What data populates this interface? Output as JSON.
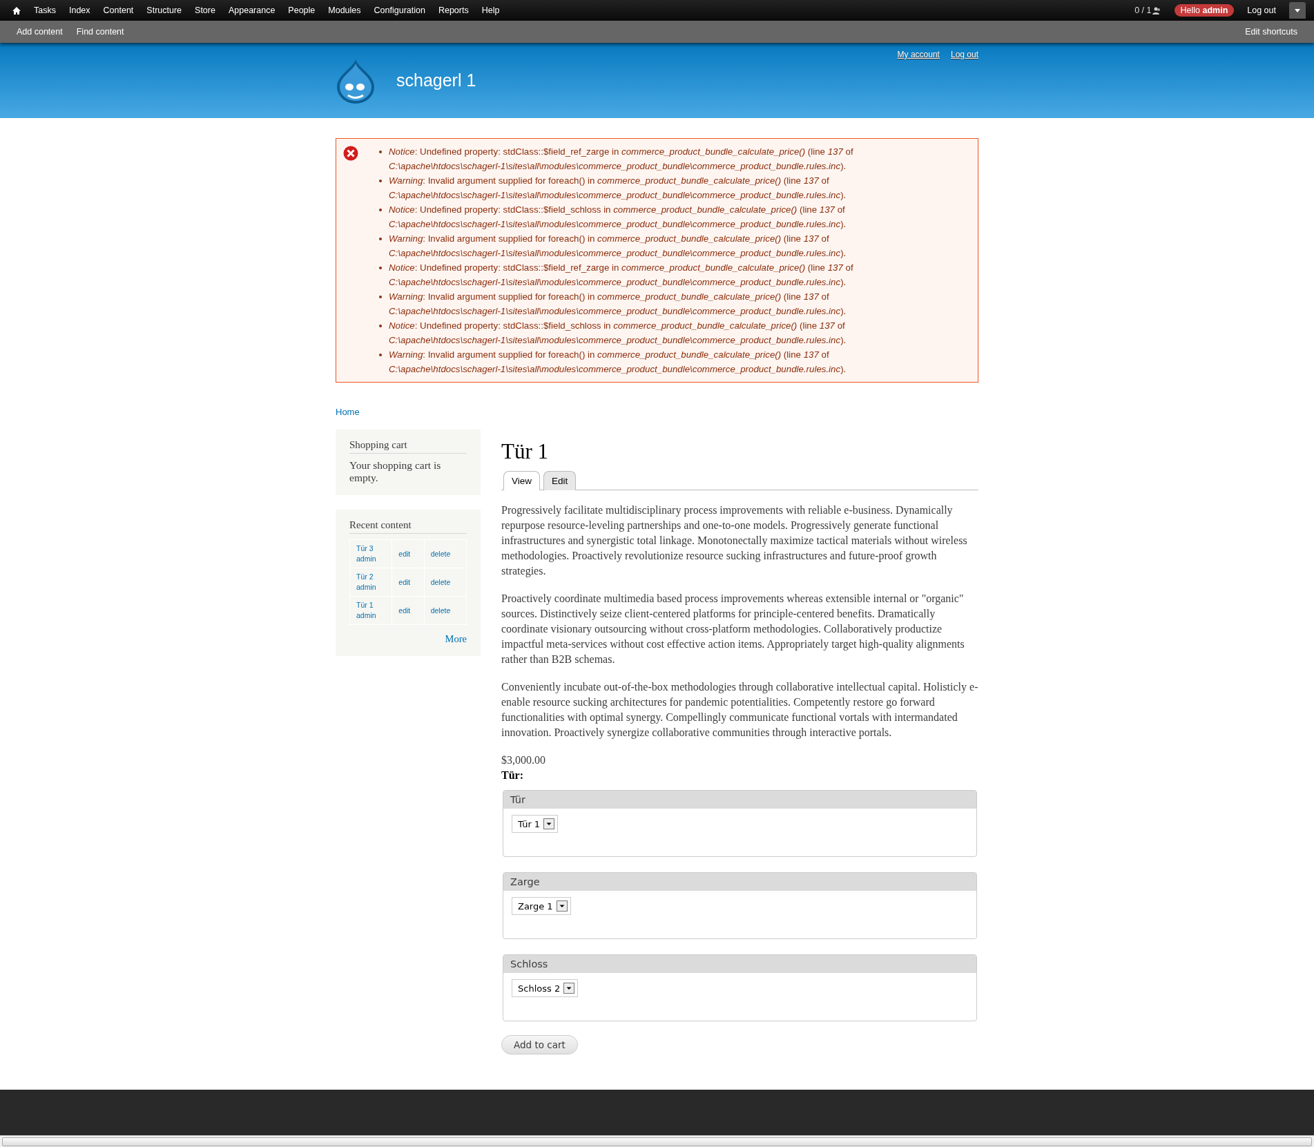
{
  "toolbar": {
    "menu": [
      "Tasks",
      "Index",
      "Content",
      "Structure",
      "Store",
      "Appearance",
      "People",
      "Modules",
      "Configuration",
      "Reports",
      "Help"
    ],
    "user_count": "0 / 1",
    "greeting": "Hello **admin**",
    "logout": "Log out"
  },
  "shortcuts": {
    "items": [
      "Add content",
      "Find content"
    ],
    "edit": "Edit shortcuts"
  },
  "header": {
    "site_name": "schagerl 1",
    "links": [
      "My account",
      "Log out"
    ]
  },
  "messages": [
    "*Notice*: Undefined property: stdClass::$field_ref_zarge in *commerce_product_bundle_calculate_price()* (line *137* of *C:\\apache\\htdocs\\schagerl-1\\sites\\all\\modules\\commerce_product_bundle\\commerce_product_bundle.rules.inc*).",
    "*Warning*: Invalid argument supplied for foreach() in *commerce_product_bundle_calculate_price()* (line *137* of *C:\\apache\\htdocs\\schagerl-1\\sites\\all\\modules\\commerce_product_bundle\\commerce_product_bundle.rules.inc*).",
    "*Notice*: Undefined property: stdClass::$field_schloss in *commerce_product_bundle_calculate_price()* (line *137* of *C:\\apache\\htdocs\\schagerl-1\\sites\\all\\modules\\commerce_product_bundle\\commerce_product_bundle.rules.inc*).",
    "*Warning*: Invalid argument supplied for foreach() in *commerce_product_bundle_calculate_price()* (line *137* of *C:\\apache\\htdocs\\schagerl-1\\sites\\all\\modules\\commerce_product_bundle\\commerce_product_bundle.rules.inc*).",
    "*Notice*: Undefined property: stdClass::$field_ref_zarge in *commerce_product_bundle_calculate_price()* (line *137* of *C:\\apache\\htdocs\\schagerl-1\\sites\\all\\modules\\commerce_product_bundle\\commerce_product_bundle.rules.inc*).",
    "*Warning*: Invalid argument supplied for foreach() in *commerce_product_bundle_calculate_price()* (line *137* of *C:\\apache\\htdocs\\schagerl-1\\sites\\all\\modules\\commerce_product_bundle\\commerce_product_bundle.rules.inc*).",
    "*Notice*: Undefined property: stdClass::$field_schloss in *commerce_product_bundle_calculate_price()* (line *137* of *C:\\apache\\htdocs\\schagerl-1\\sites\\all\\modules\\commerce_product_bundle\\commerce_product_bundle.rules.inc*).",
    "*Warning*: Invalid argument supplied for foreach() in *commerce_product_bundle_calculate_price()* (line *137* of *C:\\apache\\htdocs\\schagerl-1\\sites\\all\\modules\\commerce_product_bundle\\commerce_product_bundle.rules.inc*)."
  ],
  "breadcrumb": [
    "Home"
  ],
  "sidebar": {
    "cart": {
      "title": "Shopping cart",
      "text": "Your shopping cart is empty."
    },
    "recent": {
      "title": "Recent content",
      "rows": [
        {
          "title": "Tür 3",
          "author": "admin",
          "edit": "edit",
          "delete": "delete"
        },
        {
          "title": "Tür 2",
          "author": "admin",
          "edit": "edit",
          "delete": "delete"
        },
        {
          "title": "Tür 1",
          "author": "admin",
          "edit": "edit",
          "delete": "delete"
        }
      ],
      "more": "More"
    }
  },
  "node": {
    "title": "Tür 1",
    "tabs": [
      {
        "label": "View",
        "selected": true
      },
      {
        "label": "Edit",
        "selected": false
      }
    ],
    "paragraphs": [
      "Progressively facilitate multidisciplinary process improvements with reliable e-business. Dynamically repurpose resource-leveling partnerships and one-to-one models. Progressively generate functional infrastructures and synergistic total linkage. Monotonectally maximize tactical materials without wireless methodologies. Proactively revolutionize resource sucking infrastructures and future-proof growth strategies.",
      "Proactively coordinate multimedia based process improvements whereas extensible internal or \"organic\" sources. Distinctively seize client-centered platforms for principle-centered benefits. Dramatically coordinate visionary outsourcing without cross-platform methodologies. Collaboratively productize impactful meta-services without cost effective action items. Appropriately target high-quality alignments rather than B2B schemas.",
      "Conveniently incubate out-of-the-box methodologies through collaborative intellectual capital. Holisticly e-enable resource sucking architectures for pandemic potentialities. Competently restore go forward functionalities with optimal synergy. Compellingly communicate functional vortals with intermandated innovation. Proactively synergize collaborative communities through interactive portals."
    ],
    "price": "$3,000.00",
    "field_label": "Tür:",
    "fieldsets": [
      {
        "legend": "Tür",
        "value": "Tür 1"
      },
      {
        "legend": "Zarge",
        "value": "Zarge 1"
      },
      {
        "legend": "Schloss",
        "value": "Schloss 2"
      }
    ],
    "button": "Add to cart"
  }
}
